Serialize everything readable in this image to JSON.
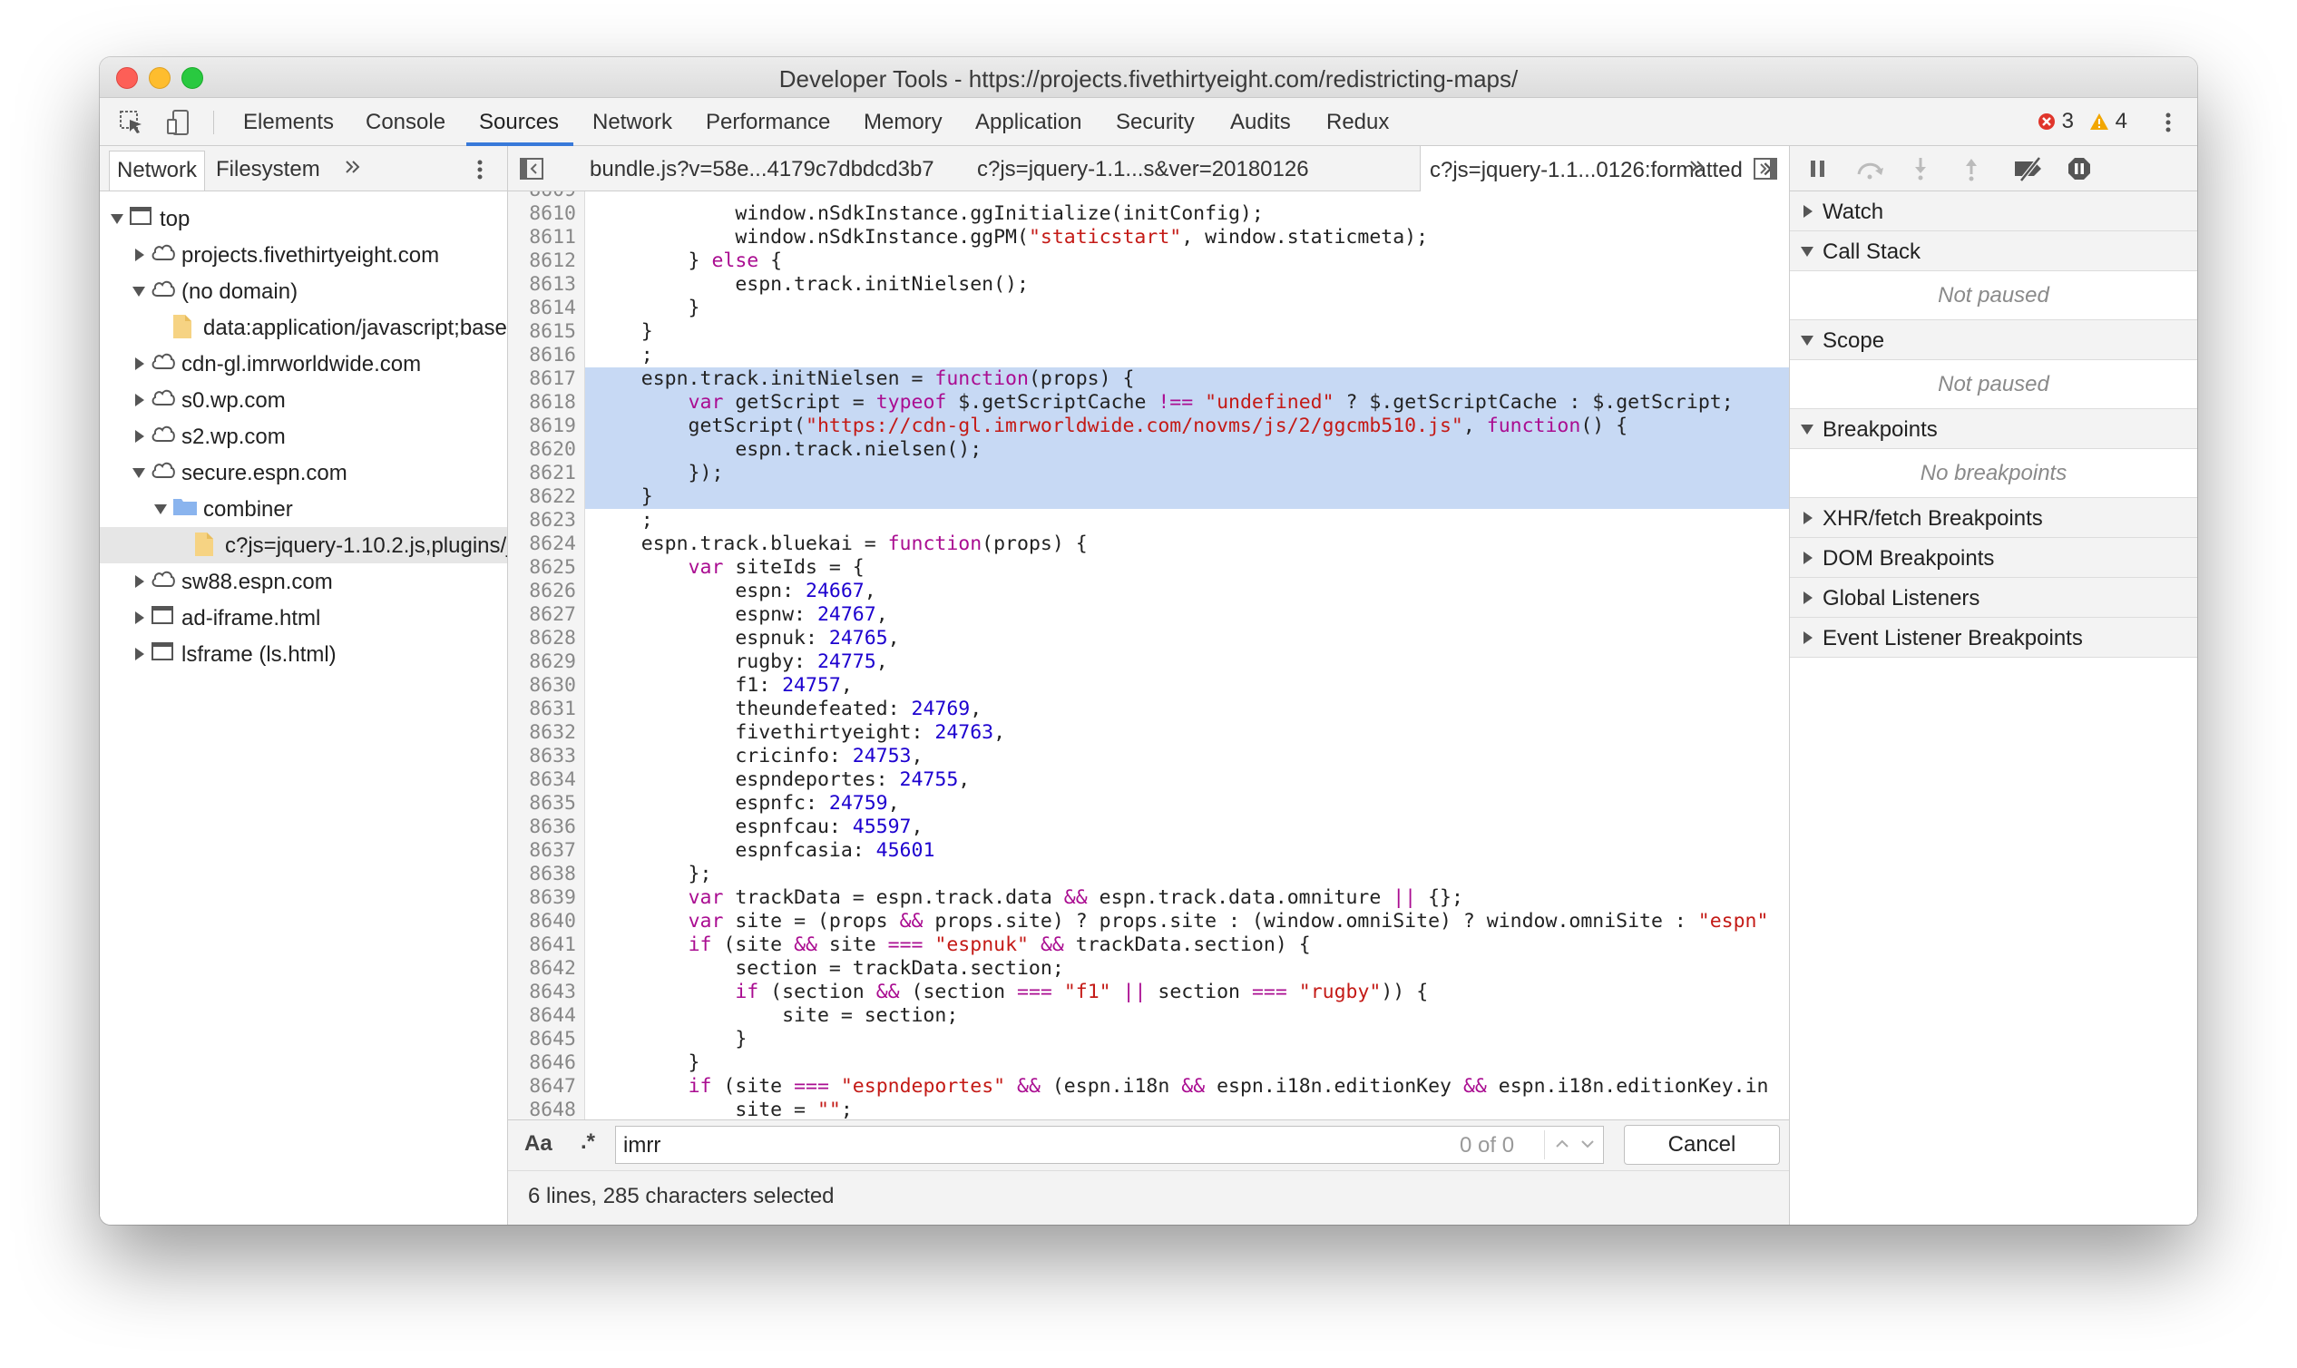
{
  "window": {
    "title": "Developer Tools - https://projects.fivethirtyeight.com/redistricting-maps/"
  },
  "toolbar": {
    "tabs": [
      "Elements",
      "Console",
      "Sources",
      "Network",
      "Performance",
      "Memory",
      "Application",
      "Security",
      "Audits",
      "Redux"
    ],
    "active_tab": "Sources",
    "errors_count": "3",
    "warnings_count": "4",
    "colors": {
      "error": "#e0352b",
      "warning": "#f2a600",
      "accent": "#3879d9"
    }
  },
  "navigator": {
    "tabs": [
      "Network",
      "Filesystem"
    ],
    "active_tab": "Network",
    "tree": [
      {
        "label": "top",
        "icon": "frame-icon",
        "arrow": "expanded"
      },
      {
        "label": "projects.fivethirtyeight.com",
        "icon": "cloud-icon",
        "arrow": "collapsed"
      },
      {
        "label": "(no domain)",
        "icon": "cloud-icon",
        "arrow": "expanded"
      },
      {
        "label": "data:application/javascript;base",
        "icon": "file-icon",
        "arrow": "none"
      },
      {
        "label": "cdn-gl.imrworldwide.com",
        "icon": "cloud-icon",
        "arrow": "collapsed"
      },
      {
        "label": "s0.wp.com",
        "icon": "cloud-icon",
        "arrow": "collapsed"
      },
      {
        "label": "s2.wp.com",
        "icon": "cloud-icon",
        "arrow": "collapsed"
      },
      {
        "label": "secure.espn.com",
        "icon": "cloud-icon",
        "arrow": "expanded"
      },
      {
        "label": "combiner",
        "icon": "folder-icon",
        "arrow": "expanded"
      },
      {
        "label": "c?js=jquery-1.10.2.js,plugins/j",
        "icon": "file-icon",
        "arrow": "none",
        "selected": true
      },
      {
        "label": "sw88.espn.com",
        "icon": "cloud-icon",
        "arrow": "collapsed"
      },
      {
        "label": "ad-iframe.html",
        "icon": "frame-icon",
        "arrow": "collapsed"
      },
      {
        "label": "lsframe (ls.html)",
        "icon": "frame-icon",
        "arrow": "collapsed"
      }
    ]
  },
  "editor": {
    "tabs": [
      {
        "label": "bundle.js?v=58e...4179c7dbdcd3b7"
      },
      {
        "label": "c?js=jquery-1.1...s&ver=20180126"
      },
      {
        "label": "c?js=jquery-1.1...0126:formatted",
        "active": true,
        "closable": true
      }
    ],
    "lines": [
      {
        "n": "8610",
        "t": "            window.nSdkInstance.ggInitialize(initConfig);"
      },
      {
        "n": "8611",
        "t": "            window.nSdkInstance.ggPM(\"staticstart\", window.staticmeta);"
      },
      {
        "n": "8612",
        "t": "        } else {"
      },
      {
        "n": "8613",
        "t": "            espn.track.initNielsen();"
      },
      {
        "n": "8614",
        "t": "        }"
      },
      {
        "n": "8615",
        "t": "    }"
      },
      {
        "n": "8616",
        "t": "    ;"
      },
      {
        "n": "8617",
        "t": "    espn.track.initNielsen = function(props) {",
        "sel": true
      },
      {
        "n": "8618",
        "t": "        var getScript = typeof $.getScriptCache !== \"undefined\" ? $.getScriptCache : $.getScript;",
        "sel": true
      },
      {
        "n": "8619",
        "t": "        getScript(\"https://cdn-gl.imrworldwide.com/novms/js/2/ggcmb510.js\", function() {",
        "sel": true
      },
      {
        "n": "8620",
        "t": "            espn.track.nielsen();",
        "sel": true
      },
      {
        "n": "8621",
        "t": "        });",
        "sel": true
      },
      {
        "n": "8622",
        "t": "    }",
        "sel": true
      },
      {
        "n": "8623",
        "t": "    ;"
      },
      {
        "n": "8624",
        "t": "    espn.track.bluekai = function(props) {"
      },
      {
        "n": "8625",
        "t": "        var siteIds = {"
      },
      {
        "n": "8626",
        "t": "            espn: 24667,"
      },
      {
        "n": "8627",
        "t": "            espnw: 24767,"
      },
      {
        "n": "8628",
        "t": "            espnuk: 24765,"
      },
      {
        "n": "8629",
        "t": "            rugby: 24775,"
      },
      {
        "n": "8630",
        "t": "            f1: 24757,"
      },
      {
        "n": "8631",
        "t": "            theundefeated: 24769,"
      },
      {
        "n": "8632",
        "t": "            fivethirtyeight: 24763,"
      },
      {
        "n": "8633",
        "t": "            cricinfo: 24753,"
      },
      {
        "n": "8634",
        "t": "            espndeportes: 24755,"
      },
      {
        "n": "8635",
        "t": "            espnfc: 24759,"
      },
      {
        "n": "8636",
        "t": "            espnfcau: 45597,"
      },
      {
        "n": "8637",
        "t": "            espnfcasia: 45601"
      },
      {
        "n": "8638",
        "t": "        };"
      },
      {
        "n": "8639",
        "t": "        var trackData = espn.track.data && espn.track.data.omniture || {};"
      },
      {
        "n": "8640",
        "t": "        var site = (props && props.site) ? props.site : (window.omniSite) ? window.omniSite : \"espn\""
      },
      {
        "n": "8641",
        "t": "        if (site && site === \"espnuk\" && trackData.section) {"
      },
      {
        "n": "8642",
        "t": "            section = trackData.section;"
      },
      {
        "n": "8643",
        "t": "            if (section && (section === \"f1\" || section === \"rugby\")) {"
      },
      {
        "n": "8644",
        "t": "                site = section;"
      },
      {
        "n": "8645",
        "t": "            }"
      },
      {
        "n": "8646",
        "t": "        }"
      },
      {
        "n": "8647",
        "t": "        if (site === \"espndeportes\" && (espn.i18n && espn.i18n.editionKey && espn.i18n.editionKey.in"
      },
      {
        "n": "8648",
        "t": "            site = \"\";"
      }
    ]
  },
  "find": {
    "case_label": "Aa",
    "regex_label": ".*",
    "query": "imrr",
    "match_count": "0 of 0",
    "cancel_label": "Cancel"
  },
  "status": {
    "text": "6 lines, 285 characters selected"
  },
  "debugger": {
    "sections": [
      {
        "label": "Watch",
        "expanded": false
      },
      {
        "label": "Call Stack",
        "expanded": true,
        "body": "Not paused"
      },
      {
        "label": "Scope",
        "expanded": true,
        "body": "Not paused"
      },
      {
        "label": "Breakpoints",
        "expanded": true,
        "body": "No breakpoints"
      },
      {
        "label": "XHR/fetch Breakpoints",
        "expanded": false
      },
      {
        "label": "DOM Breakpoints",
        "expanded": false
      },
      {
        "label": "Global Listeners",
        "expanded": false
      },
      {
        "label": "Event Listener Breakpoints",
        "expanded": false
      }
    ]
  }
}
